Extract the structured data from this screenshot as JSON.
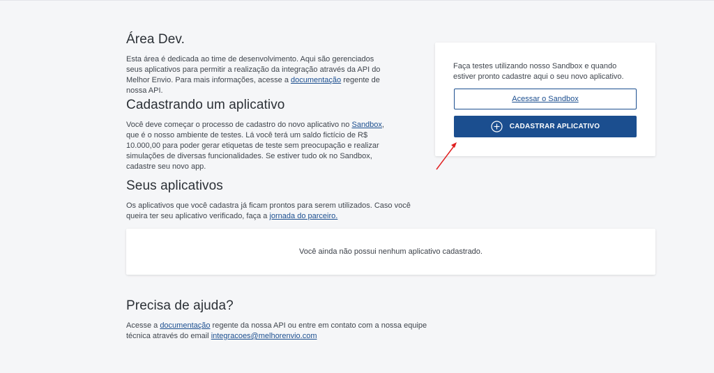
{
  "area_dev": {
    "title": "Área Dev.",
    "text_1": "Esta área é dedicada ao time de desenvolvimento. Aqui são gerenciados seus aplicativos para permitir a realização da integração através da API do Melhor Envio. Para mais informações, acesse a",
    "link": "documentação",
    "text_2": "regente de nossa API."
  },
  "cadastrando": {
    "title": "Cadastrando um aplicativo",
    "text_1": "Você deve começar o processo de cadastro do novo aplicativo no",
    "link": "Sandbox",
    "text_2": ", que é o nosso ambiente de testes. Lá você terá um saldo fictício de R$ 10.000,00 para poder gerar etiquetas de teste sem preocupação e realizar simulações de diversas funcionalidades. Se estiver tudo ok no Sandbox, cadastre seu novo app."
  },
  "sandbox_card": {
    "text": "Faça testes utilizando nosso Sandbox e quando estiver pronto cadastre aqui o seu novo aplicativo.",
    "sandbox_button": "Acessar o Sandbox",
    "register_button": "CADASTRAR APLICATIVO"
  },
  "seus_aplicativos": {
    "title": "Seus aplicativos",
    "text_1": "Os aplicativos que você cadastra já ficam prontos para serem utilizados. Caso você queira ter seu aplicativo verificado, faça a",
    "link": "jornada do parceiro.",
    "empty_message": "Você ainda não possui nenhum aplicativo cadastrado."
  },
  "ajuda": {
    "title": "Precisa de ajuda?",
    "text_1": "Acesse a",
    "link": "documentação",
    "text_2": "regente da nossa API ou entre em contato com a nossa equipe técnica através do email",
    "email": "integracoes@melhorenvio.com"
  },
  "colors": {
    "primary": "#1b4e8f",
    "background": "#f5f6f8",
    "annotation_arrow": "#e02020"
  }
}
